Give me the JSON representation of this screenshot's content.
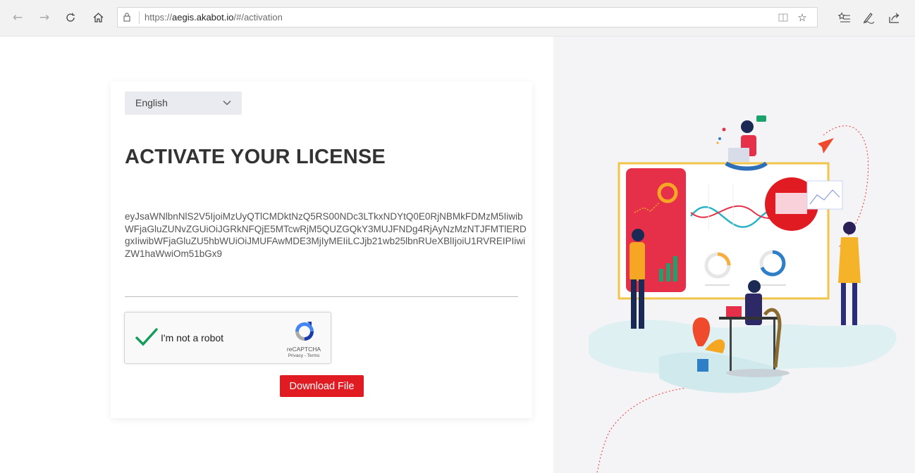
{
  "browser": {
    "url_prefix": "https://",
    "url_host": "aegis.akabot.io",
    "url_path": "/#/activation",
    "icons": {
      "back": "back-arrow-icon",
      "forward": "forward-arrow-icon",
      "refresh": "refresh-icon",
      "home": "home-icon",
      "lock": "lock-icon",
      "reading_view": "reading-view-icon",
      "favorite": "star-icon",
      "favorites_bar": "favorites-list-icon",
      "notes": "pen-icon",
      "share": "share-icon"
    }
  },
  "activation": {
    "language": "English",
    "title": "ACTIVATE YOUR LICENSE",
    "license_key": "eyJsaWNlbnNlS2V5IjoiMzUyQTlCMDktNzQ5RS00NDc3LTkxNDYtQ0E0RjNBMkFDMzM5IiwibWFjaGluZUNvZGUiOiJGRkNFQjE5MTcwRjM5QUZGQkY3MUJFNDg4RjAyNzMzNTJFMTlERDgxIiwibWFjaGluZU5hbWUiOiJMUFAwMDE3MjIyMEIiLCJjb21wb25lbnRUeXBlIjoiU1RVREIPIiwiZW1haWwiOm51bGx9",
    "captcha": {
      "label": "I'm not a robot",
      "brand": "reCAPTCHA",
      "links": "Privacy - Terms",
      "checked": true
    },
    "download_label": "Download File"
  },
  "colors": {
    "primary_red": "#e11b22",
    "check_green": "#0f9d58",
    "panel_bg": "#f4f4f6"
  }
}
